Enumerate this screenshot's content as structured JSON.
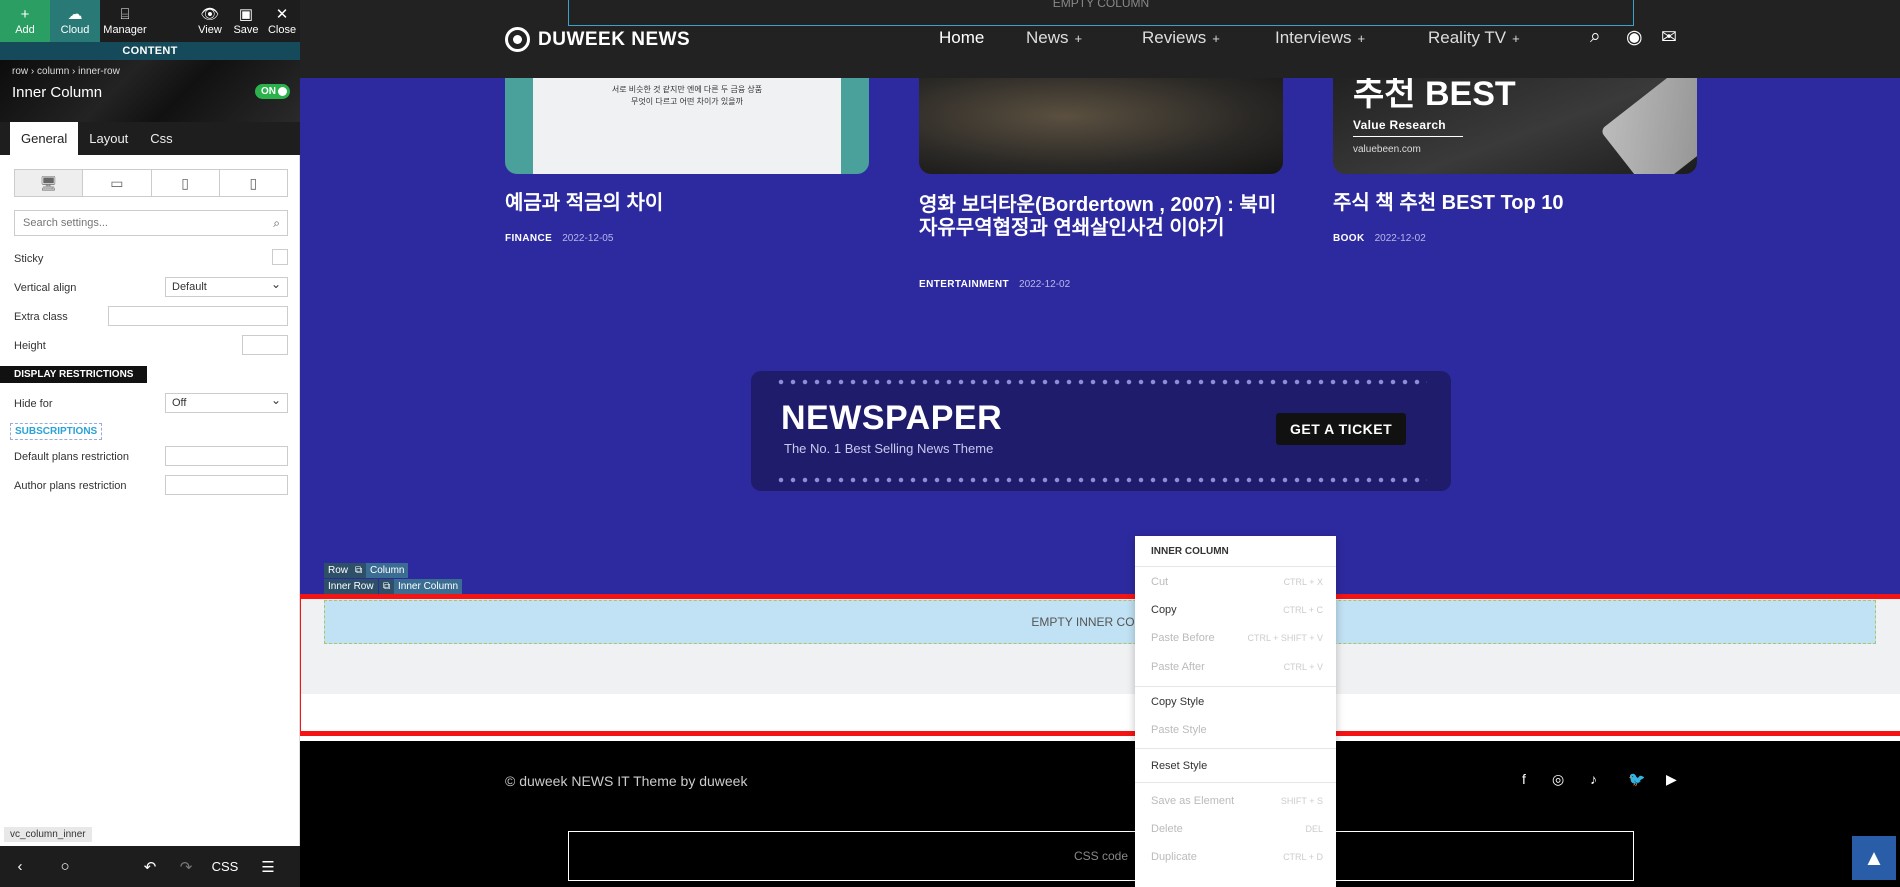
{
  "editor": {
    "toolbar": {
      "add": "Add",
      "cloud": "Cloud",
      "manager": "Manager",
      "view": "View",
      "save": "Save",
      "close": "Close"
    },
    "strip_label": "CONTENT",
    "breadcrumb": [
      "row",
      "column",
      "inner-row"
    ],
    "element_title": "Inner Column",
    "toggle": "ON",
    "tabs": [
      "General",
      "Layout",
      "Css"
    ],
    "search_placeholder": "Search settings...",
    "fields": {
      "sticky": "Sticky",
      "vertical_align": "Vertical align",
      "vertical_align_value": "Default",
      "extra_class": "Extra class",
      "height": "Height",
      "display_restrictions": "DISPLAY RESTRICTIONS",
      "hide_for": "Hide for",
      "hide_for_value": "Off",
      "subscriptions": "SUBSCRIPTIONS",
      "default_plans": "Default plans restriction",
      "author_plans": "Author plans restriction"
    },
    "footer_label": "vc_column_inner",
    "bottom": {
      "css": "CSS"
    }
  },
  "site": {
    "empty_column": "EMPTY COLUMN",
    "logo": "DUWEEK NEWS",
    "nav": [
      {
        "label": "Home",
        "plus": ""
      },
      {
        "label": "News",
        "plus": "+"
      },
      {
        "label": "Reviews",
        "plus": "+"
      },
      {
        "label": "Interviews",
        "plus": "+"
      },
      {
        "label": "Reality TV",
        "plus": "+"
      }
    ],
    "card1_img_text": [
      "서로 비슷한 것 같지만 엔에 다른 두 금융 상품",
      "무엇이 다르고 어떤 차이가 있을까"
    ],
    "card3_img": {
      "big": "추천 BEST",
      "sub": "Value Research",
      "url": "valuebeen.com"
    },
    "cards": [
      {
        "title": "예금과 적금의 차이",
        "category": "FINANCE",
        "date": "2022-12-05"
      },
      {
        "title": "영화 보더타운(Bordertown , 2007) : 북미 자유무역협정과 연쇄살인사건 이야기",
        "category": "ENTERTAINMENT",
        "date": "2022-12-02"
      },
      {
        "title": "주식 책 추천 BEST Top 10",
        "category": "BOOK",
        "date": "2022-12-02"
      }
    ],
    "ticket": {
      "title": "NEWSPAPER",
      "subtitle": "The No. 1 Best Selling News Theme",
      "button": "GET A TICKET"
    },
    "controls": {
      "row": "Row",
      "column": "Column",
      "inner_row": "Inner Row",
      "inner_column": "Inner Column"
    },
    "empty_inner": "EMPTY INNER COLUMN",
    "footer": {
      "copyright": "© duweek NEWS IT Theme by duweek",
      "css_code": "CSS code"
    }
  },
  "context_menu": {
    "title": "INNER COLUMN",
    "items": [
      {
        "label": "Cut",
        "shortcut": "CTRL + X",
        "disabled": true
      },
      {
        "label": "Copy",
        "shortcut": "CTRL + C",
        "disabled": false
      },
      {
        "label": "Paste Before",
        "shortcut": "CTRL + SHIFT + V",
        "disabled": true
      },
      {
        "label": "Paste After",
        "shortcut": "CTRL + V",
        "disabled": true
      },
      {
        "label": "Copy Style",
        "shortcut": "",
        "disabled": false
      },
      {
        "label": "Paste Style",
        "shortcut": "",
        "disabled": true
      },
      {
        "label": "Reset Style",
        "shortcut": "",
        "disabled": false
      },
      {
        "label": "Save as Element",
        "shortcut": "SHIFT + S",
        "disabled": true
      },
      {
        "label": "Delete",
        "shortcut": "DEL",
        "disabled": true
      },
      {
        "label": "Duplicate",
        "shortcut": "CTRL + D",
        "disabled": true
      }
    ]
  },
  "colors": {
    "site_bg": "#2d2a9f",
    "nav_bg": "#222222",
    "accent_green": "#2b9e63",
    "highlight_red": "#f41414",
    "empty_inner_bg": "#c1e2f4"
  }
}
